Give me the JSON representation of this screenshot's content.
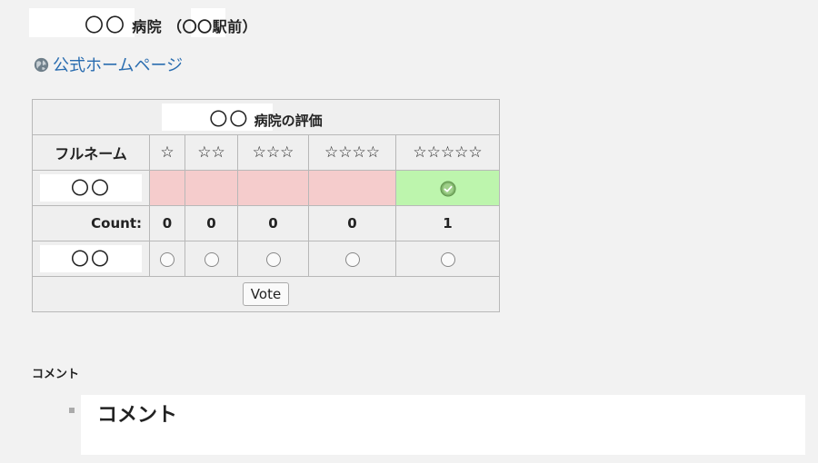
{
  "page": {
    "title_name": "〇〇",
    "title_rest": " 病院 （〇〇駅前）",
    "homepage_link": "公式ホームページ"
  },
  "rating": {
    "title_name": "〇〇",
    "title_rest": " 病院の評価",
    "col_name": "フルネーム",
    "columns": [
      "☆",
      "☆☆",
      "☆☆☆",
      "☆☆☆☆",
      "☆☆☆☆☆"
    ],
    "result_row_name": "〇〇",
    "count_label": "Count:",
    "counts": [
      "0",
      "0",
      "0",
      "0",
      "1"
    ],
    "vote_row_name": "〇〇",
    "vote_button": "Vote"
  },
  "comments": {
    "heading": "コメント",
    "items": [
      "コメント"
    ]
  },
  "colors": {
    "link": "#2a6db0",
    "pink_cell": "#f5cccc",
    "green_cell": "#bdf5ad"
  }
}
